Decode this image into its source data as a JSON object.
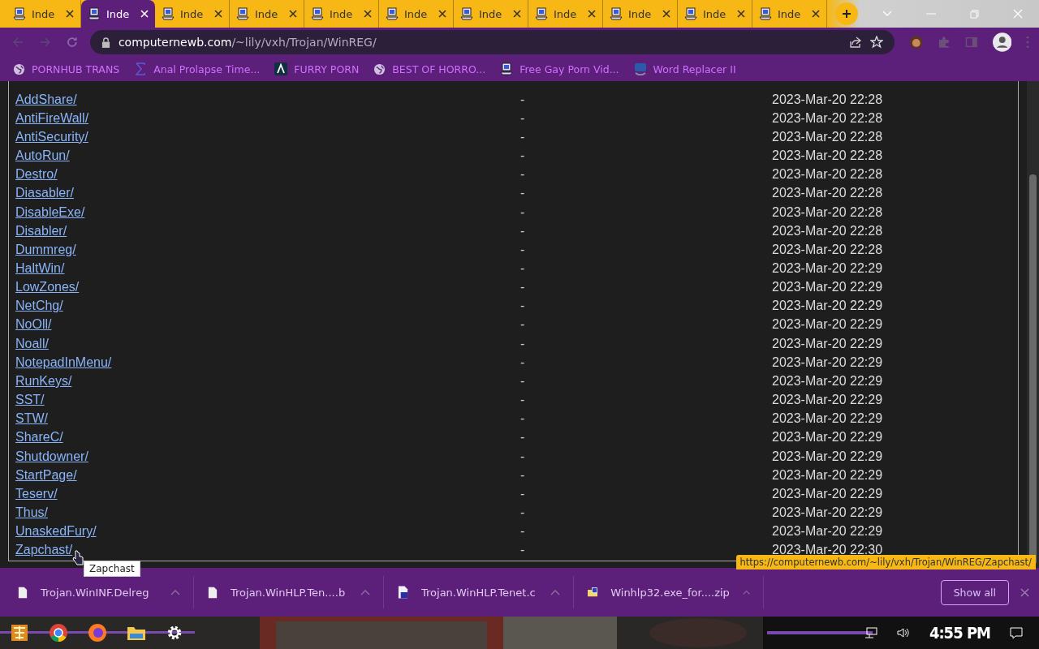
{
  "tabs": [
    {
      "title": "Inde",
      "selected": false
    },
    {
      "title": "Inde",
      "selected": true
    },
    {
      "title": "Inde",
      "selected": false
    },
    {
      "title": "Inde",
      "selected": false
    },
    {
      "title": "Inde",
      "selected": false
    },
    {
      "title": "Inde",
      "selected": false
    },
    {
      "title": "Inde",
      "selected": false
    },
    {
      "title": "Inde",
      "selected": false
    },
    {
      "title": "Inde",
      "selected": false
    },
    {
      "title": "Inde",
      "selected": false
    },
    {
      "title": "Inde",
      "selected": false
    }
  ],
  "address_bar": {
    "host": "computernewb.com",
    "path": "/~lily/vxh/Trojan/WinREG/"
  },
  "bookmarks": [
    {
      "label": "PORNHUB TRANS",
      "kind": "globe"
    },
    {
      "label": "Anal Prolapse Time...",
      "kind": "sigma"
    },
    {
      "label": "FURRY PORN",
      "kind": "lambda"
    },
    {
      "label": "BEST OF HORRO...",
      "kind": "globe"
    },
    {
      "label": "Free Gay Porn Vid...",
      "kind": "computer"
    },
    {
      "label": "Word Replacer II",
      "kind": "wr"
    }
  ],
  "listing": [
    {
      "name": "AddShare/",
      "size": "-",
      "modified": "2023-Mar-20 22:28"
    },
    {
      "name": "AntiFireWall/",
      "size": "-",
      "modified": "2023-Mar-20 22:28"
    },
    {
      "name": "AntiSecurity/",
      "size": "-",
      "modified": "2023-Mar-20 22:28"
    },
    {
      "name": "AutoRun/",
      "size": "-",
      "modified": "2023-Mar-20 22:28"
    },
    {
      "name": "Destro/",
      "size": "-",
      "modified": "2023-Mar-20 22:28"
    },
    {
      "name": "Diasabler/",
      "size": "-",
      "modified": "2023-Mar-20 22:28"
    },
    {
      "name": "DisableExe/",
      "size": "-",
      "modified": "2023-Mar-20 22:28"
    },
    {
      "name": "Disabler/",
      "size": "-",
      "modified": "2023-Mar-20 22:28"
    },
    {
      "name": "Dummreg/",
      "size": "-",
      "modified": "2023-Mar-20 22:28"
    },
    {
      "name": "HaltWin/",
      "size": "-",
      "modified": "2023-Mar-20 22:29"
    },
    {
      "name": "LowZones/",
      "size": "-",
      "modified": "2023-Mar-20 22:29"
    },
    {
      "name": "NetChg/",
      "size": "-",
      "modified": "2023-Mar-20 22:29"
    },
    {
      "name": "NoOll/",
      "size": "-",
      "modified": "2023-Mar-20 22:29"
    },
    {
      "name": "Noall/",
      "size": "-",
      "modified": "2023-Mar-20 22:29"
    },
    {
      "name": "NotepadInMenu/",
      "size": "-",
      "modified": "2023-Mar-20 22:29"
    },
    {
      "name": "RunKeys/",
      "size": "-",
      "modified": "2023-Mar-20 22:29"
    },
    {
      "name": "SST/",
      "size": "-",
      "modified": "2023-Mar-20 22:29"
    },
    {
      "name": "STW/",
      "size": "-",
      "modified": "2023-Mar-20 22:29"
    },
    {
      "name": "ShareC/",
      "size": "-",
      "modified": "2023-Mar-20 22:29"
    },
    {
      "name": "Shutdowner/",
      "size": "-",
      "modified": "2023-Mar-20 22:29"
    },
    {
      "name": "StartPage/",
      "size": "-",
      "modified": "2023-Mar-20 22:29"
    },
    {
      "name": "Teserv/",
      "size": "-",
      "modified": "2023-Mar-20 22:29"
    },
    {
      "name": "Thus/",
      "size": "-",
      "modified": "2023-Mar-20 22:29"
    },
    {
      "name": "UnaskedFury/",
      "size": "-",
      "modified": "2023-Mar-20 22:29"
    },
    {
      "name": "Zapchast/",
      "size": "-",
      "modified": "2023-Mar-20 22:30"
    }
  ],
  "tooltip": "Zapchast",
  "status_url": "https://computernewb.com/~lily/vxh/Trojan/WinREG/Zapchast/",
  "downloads": [
    {
      "name": "Trojan.WinINF.Delreg",
      "kind": "file"
    },
    {
      "name": "Trojan.WinHLP.Ten....b",
      "kind": "file"
    },
    {
      "name": "Trojan.WinHLP.Tenet.c",
      "kind": "source"
    },
    {
      "name": "Winhlp32.exe_for....zip",
      "kind": "zip"
    }
  ],
  "show_all": "Show all",
  "clock": "4:55 PM"
}
